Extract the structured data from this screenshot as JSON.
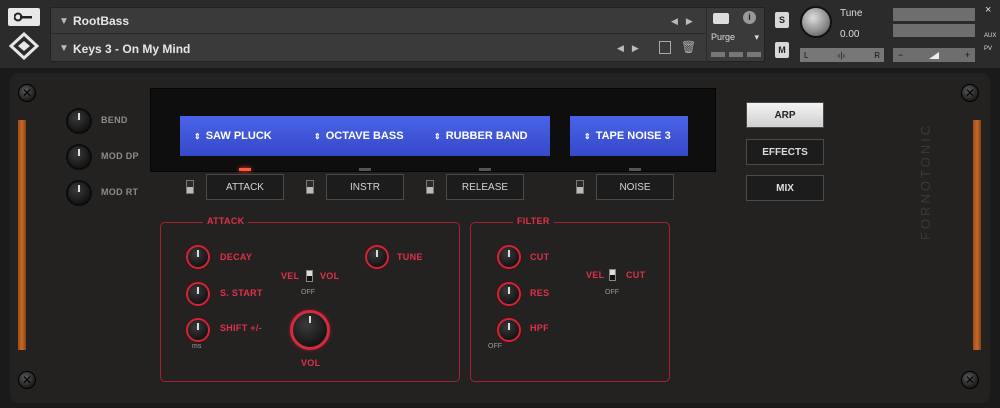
{
  "header": {
    "instrument_name": "RootBass",
    "preset_name": "Keys 3 - On My Mind",
    "purge_label": "Purge",
    "solo_label": "S",
    "mute_label": "M",
    "tune_label": "Tune",
    "tune_value": "0.00",
    "pan_left": "L",
    "pan_right": "R",
    "vol_minus": "−",
    "vol_plus": "+",
    "aux_label": "AUX",
    "pv_label": "PV",
    "close_label": "×"
  },
  "left_knobs": [
    {
      "label": "BEND"
    },
    {
      "label": "MOD DP"
    },
    {
      "label": "MOD RT"
    }
  ],
  "slots": {
    "saw": "SAW PLUCK",
    "octave": "OCTAVE BASS",
    "rubber": "RUBBER BAND",
    "tape": "TAPE NOISE 3"
  },
  "tabs": {
    "attack": "ATTACK",
    "instr": "INSTR",
    "release": "RELEASE",
    "noise": "NOISE"
  },
  "side_buttons": {
    "arp": "ARP",
    "effects": "EFFECTS",
    "mix": "MIX"
  },
  "attack_section": {
    "title": "ATTACK",
    "decay": "DECAY",
    "s_start": "S. START",
    "shift": "SHIFT +/-",
    "ms": "ms",
    "vel": "VEL",
    "vol": "VOL",
    "off": "OFF",
    "tune": "TUNE",
    "vol_knob": "VOL"
  },
  "filter_section": {
    "title": "FILTER",
    "cut": "CUT",
    "res": "RES",
    "hpf": "HPF",
    "off": "OFF",
    "vel": "VEL",
    "cut2": "CUT",
    "off2": "OFF"
  },
  "brand": "FORNOTONIC",
  "colors": {
    "accent_red": "#e0304a",
    "display_blue": "#3f56d8",
    "led_active": "#ff5a3c",
    "wood": "#b85f22"
  }
}
